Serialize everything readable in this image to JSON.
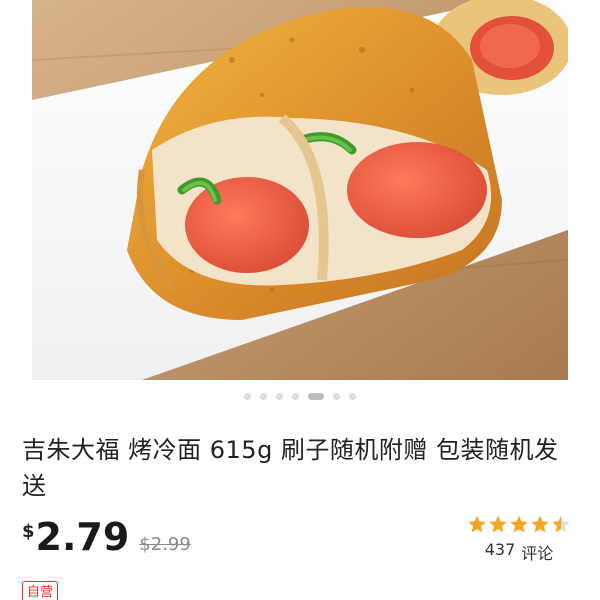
{
  "product": {
    "image_alt": "food-image",
    "carousel": {
      "count": 7,
      "active_index": 4
    },
    "title": "吉朱大福 烤冷面 615g 刷子随机附赠 包装随机发送",
    "price": {
      "currency": "$",
      "current": "2.79",
      "original": "$2.99"
    },
    "rating": {
      "stars": 4.5,
      "count": "437",
      "label": "评论",
      "star_color": "#f5a623"
    },
    "badge": "自营"
  },
  "colors": {
    "badge": "#e0352b",
    "price": "#1a1a1a"
  }
}
